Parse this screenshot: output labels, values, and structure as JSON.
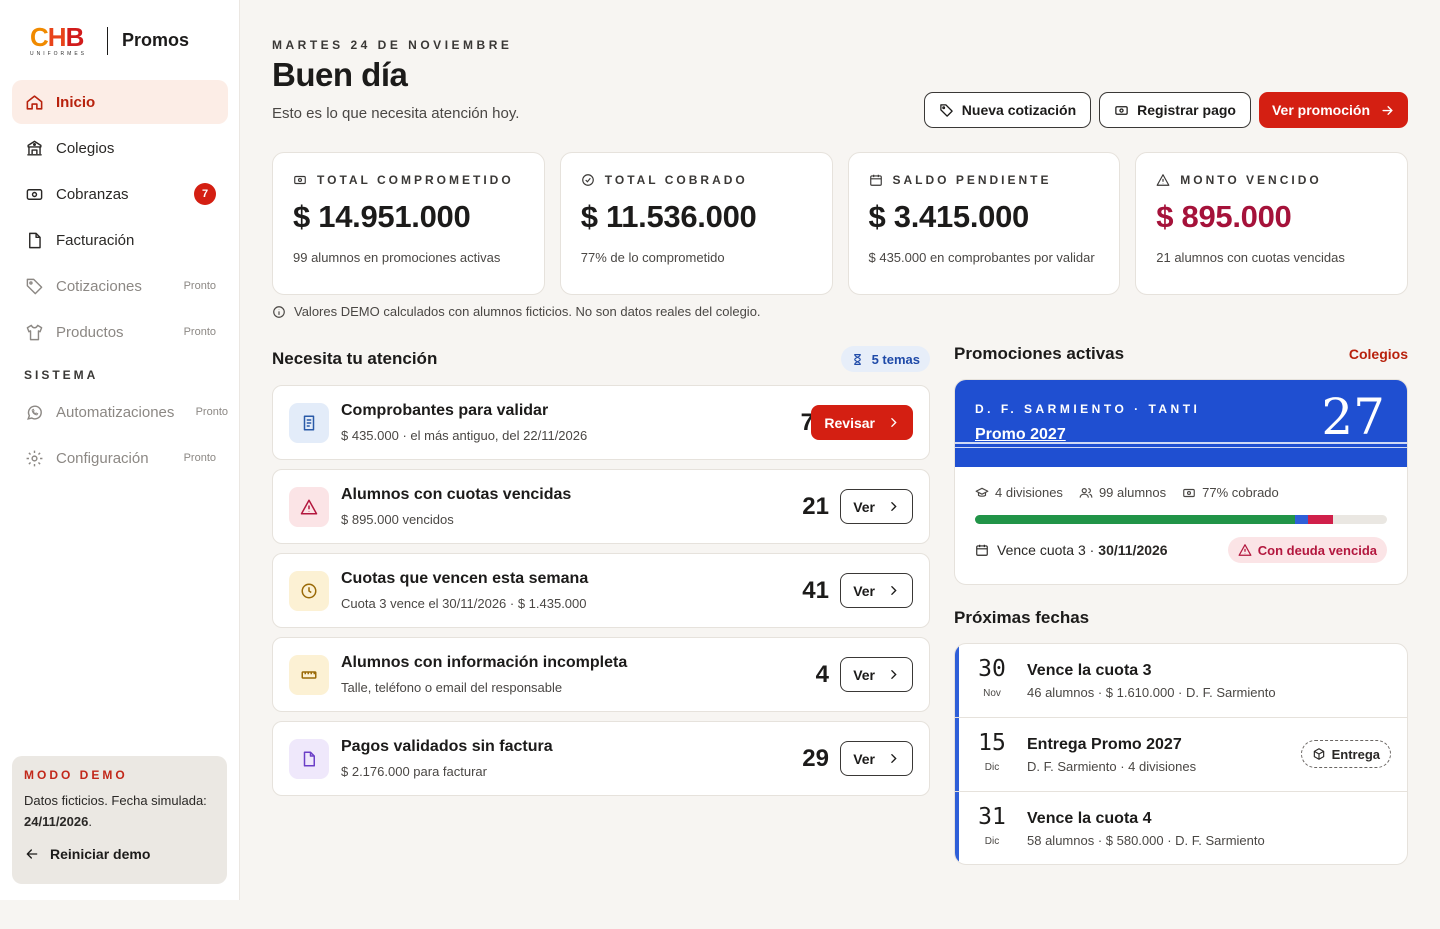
{
  "logo": {
    "brand": "CHB",
    "brand_sub": "UNIFORMES",
    "app": "Promos"
  },
  "sidebar": {
    "items": [
      {
        "label": "Inicio"
      },
      {
        "label": "Colegios"
      },
      {
        "label": "Cobranzas",
        "badge": "7"
      },
      {
        "label": "Facturación"
      },
      {
        "label": "Cotizaciones",
        "tag": "Pronto"
      },
      {
        "label": "Productos",
        "tag": "Pronto"
      }
    ],
    "section": "SISTEMA",
    "system_items": [
      {
        "label": "Automatizaciones",
        "tag": "Pronto"
      },
      {
        "label": "Configuración",
        "tag": "Pronto"
      }
    ],
    "demo": {
      "title": "MODO DEMO",
      "text": "Datos ficticios. Fecha simulada:",
      "date": "24/11/2026",
      "reset": "Reiniciar demo"
    }
  },
  "header": {
    "date": "MARTES 24 DE NOVIEMBRE",
    "greeting": "Buen día",
    "subtitle": "Esto es lo que necesita atención hoy.",
    "actions": {
      "new_quote": "Nueva cotización",
      "register_payment": "Registrar pago",
      "see_promo": "Ver promoción"
    }
  },
  "kpis": [
    {
      "label": "TOTAL COMPROMETIDO",
      "value": "$ 14.951.000",
      "note": "99 alumnos en promociones activas",
      "icon": "money-icon"
    },
    {
      "label": "TOTAL COBRADO",
      "value": "$ 11.536.000",
      "note": "77% de lo comprometido",
      "icon": "check-circle-icon"
    },
    {
      "label": "SALDO PENDIENTE",
      "value": "$ 3.415.000",
      "note": "$ 435.000 en comprobantes por validar",
      "icon": "calendar-icon"
    },
    {
      "label": "MONTO VENCIDO",
      "value": "$ 895.000",
      "note": "21 alumnos con cuotas vencidas",
      "icon": "warning-icon",
      "color": "#a5123a"
    }
  ],
  "disclaimer": "Valores DEMO calculados con alumnos ficticios. No son datos reales del colegio.",
  "attention": {
    "title": "Necesita tu atención",
    "chip": "5 temas",
    "items": [
      {
        "title": "Comprobantes para validar",
        "sub": "$ 435.000 · el más antiguo, del 22/11/2026",
        "count": "7",
        "button": "Revisar",
        "icon": "receipt-icon",
        "icon_bg": "#e3ecf9",
        "icon_color": "#2a5aa8"
      },
      {
        "title": "Alumnos con cuotas vencidas",
        "sub": "$ 895.000 vencidos",
        "count": "21",
        "button": "Ver",
        "icon": "warning-icon",
        "icon_bg": "#fbe4e6",
        "icon_color": "#b3173e"
      },
      {
        "title": "Cuotas que vencen esta semana",
        "sub": "Cuota 3 vence el 30/11/2026 · $ 1.435.000",
        "count": "41",
        "button": "Ver",
        "icon": "clock-icon",
        "icon_bg": "#fcf1d4",
        "icon_color": "#9a6a08"
      },
      {
        "title": "Alumnos con información incompleta",
        "sub": "Talle, teléfono o email del responsable",
        "count": "4",
        "button": "Ver",
        "icon": "ruler-icon",
        "icon_bg": "#fcf1d4",
        "icon_color": "#9a6a08"
      },
      {
        "title": "Pagos validados sin factura",
        "sub": "$ 2.176.000 para facturar",
        "count": "29",
        "button": "Ver",
        "icon": "file-icon",
        "icon_bg": "#efe8fb",
        "icon_color": "#6b3fc7"
      }
    ]
  },
  "promos": {
    "title": "Promociones activas",
    "link": "Colegios",
    "card": {
      "school": "D. F. SARMIENTO · TANTI",
      "name": "Promo 2027",
      "number": "27",
      "divisions": "4 divisiones",
      "students": "99 alumnos",
      "collected": "77% cobrado",
      "progress": {
        "paid": 0.776,
        "pending": 0.032,
        "overdue": 0.06
      },
      "due_label": "Vence cuota 3 ·",
      "due_date": "30/11/2026",
      "status": "Con deuda vencida"
    }
  },
  "upcoming": {
    "title": "Próximas fechas",
    "items": [
      {
        "day": "30",
        "month": "Nov",
        "title": "Vence la cuota 3",
        "sub": "46 alumnos · $ 1.610.000 · D. F. Sarmiento"
      },
      {
        "day": "15",
        "month": "Dic",
        "title": "Entrega Promo 2027",
        "sub": "D. F. Sarmiento · 4 divisiones",
        "chip": "Entrega"
      },
      {
        "day": "31",
        "month": "Dic",
        "title": "Vence la cuota 4",
        "sub": "58 alumnos · $ 580.000 · D. F. Sarmiento"
      }
    ]
  }
}
